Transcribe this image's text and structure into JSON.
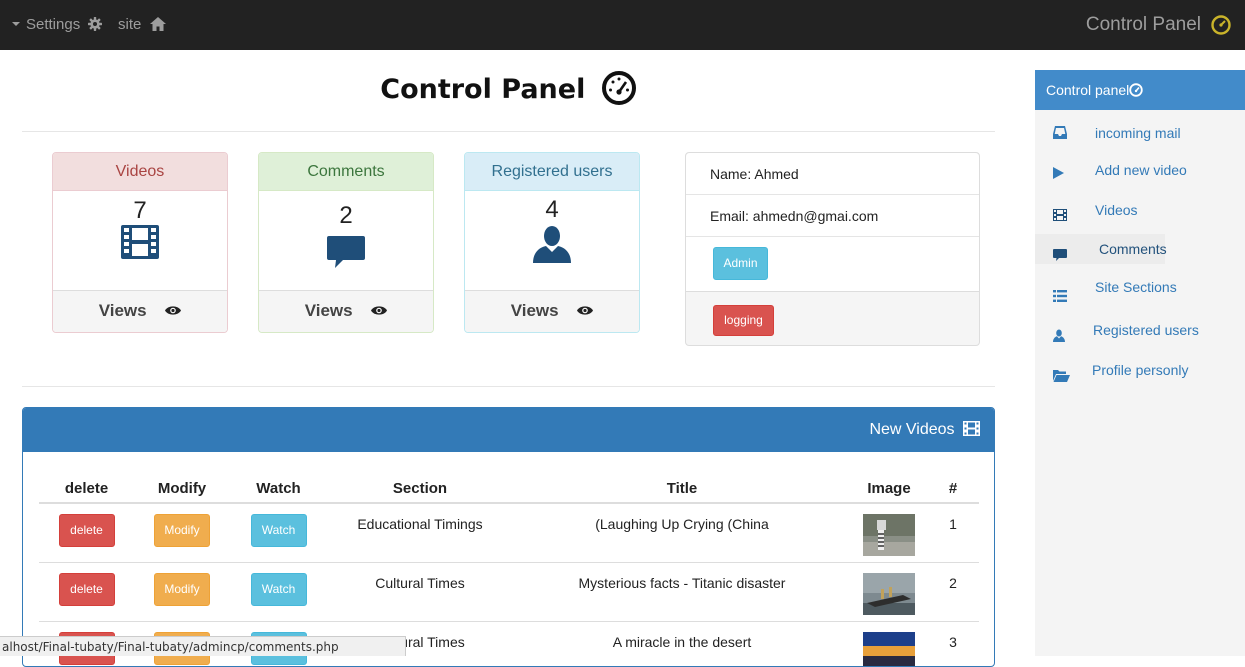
{
  "navbar": {
    "settings_label": "Settings",
    "site_label": "site",
    "brand": "Control Panel"
  },
  "main": {
    "title": "Control Panel",
    "stats": [
      {
        "heading": "Videos",
        "count": "7",
        "footer": "Views",
        "icon": "film-icon"
      },
      {
        "heading": "Comments",
        "count": "2",
        "footer": "Views",
        "icon": "comment-icon"
      },
      {
        "heading": "Registered users",
        "count": "4",
        "footer": "Views",
        "icon": "user-icon"
      }
    ],
    "profile": {
      "name": "Name: Ahmed",
      "email": "Email: ahmedn@gmai.com",
      "role_button": "Admin",
      "logout_button": "logging"
    }
  },
  "sidebar": {
    "title": "Control panel",
    "items": [
      {
        "label": "incoming mail",
        "icon": "inbox-icon"
      },
      {
        "label": "Add new video",
        "icon": "play-icon"
      },
      {
        "label": "Videos",
        "icon": "film-icon"
      },
      {
        "label": "Comments",
        "icon": "comment-icon"
      },
      {
        "label": "Site Sections",
        "icon": "list-icon"
      },
      {
        "label": "Registered users",
        "icon": "user-icon"
      },
      {
        "label": "Profile personly",
        "icon": "folder-open-icon"
      }
    ]
  },
  "videos_panel": {
    "title": "New Videos",
    "columns": [
      "delete",
      "Modify",
      "Watch",
      "Section",
      "Title",
      "Image",
      "#"
    ],
    "rows": [
      {
        "delete": "delete",
        "modify": "Modify",
        "watch": "Watch",
        "section": "Educational Timings",
        "title": "(Laughing Up Crying (China",
        "index": "1"
      },
      {
        "delete": "delete",
        "modify": "Modify",
        "watch": "Watch",
        "section": "Cultural Times",
        "title": "Mysterious facts - Titanic disaster",
        "index": "2"
      },
      {
        "delete": "delete",
        "modify": "Modify",
        "watch": "Watch",
        "section": "Cultural Times",
        "title": "A miracle in the desert",
        "index": "3"
      }
    ]
  },
  "status_url": "alhost/Final-tubaty/Final-tubaty/admincp/comments.php",
  "colors": {
    "navbar": "#222222",
    "primary": "#337ab7",
    "sidebar_head": "#428bca",
    "danger": "#d9534f",
    "warning": "#f0ad4e",
    "info": "#5bc0de"
  }
}
